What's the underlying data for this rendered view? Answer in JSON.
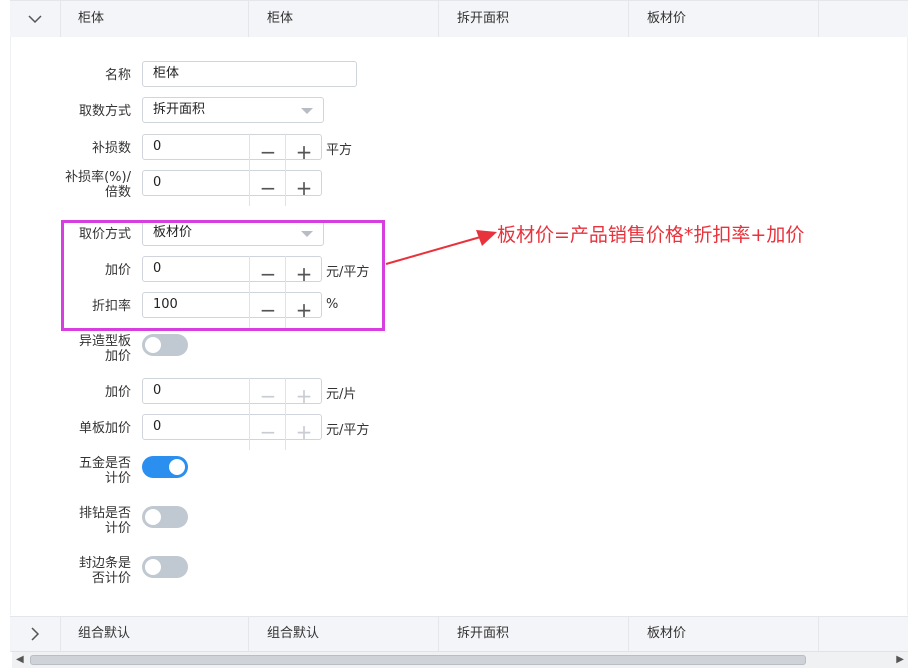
{
  "header_row": {
    "cells": [
      "柜体",
      "柜体",
      "拆开面积",
      "板材价"
    ]
  },
  "form": {
    "name": {
      "label": "名称",
      "value": "柜体"
    },
    "fetch_mode": {
      "label": "取数方式",
      "value": "拆开面积"
    },
    "loss": {
      "label": "补损数",
      "value": "0",
      "unit": "平方"
    },
    "loss_rate": {
      "label_line1": "补损率(%)/",
      "label_line2": "倍数",
      "value": "0"
    },
    "price_mode": {
      "label": "取价方式",
      "value": "板材价"
    },
    "add_price": {
      "label": "加价",
      "value": "0",
      "unit": "元/平方"
    },
    "discount": {
      "label": "折扣率",
      "value": "100",
      "unit": "%"
    },
    "special_board": {
      "label_line1": "异造型板",
      "label_line2": "加价",
      "on": false
    },
    "add_price2": {
      "label": "加价",
      "value": "0",
      "unit": "元/片"
    },
    "single_board": {
      "label": "单板加价",
      "value": "0",
      "unit": "元/平方"
    },
    "hardware": {
      "label_line1": "五金是否",
      "label_line2": "计价",
      "on": true
    },
    "drilling": {
      "label_line1": "排钻是否",
      "label_line2": "计价",
      "on": false
    },
    "edge_band": {
      "label_line1": "封边条是",
      "label_line2": "否计价",
      "on": false
    }
  },
  "annotation": "板材价=产品销售价格*折扣率+加价",
  "footer_row": {
    "cells": [
      "组合默认",
      "组合默认",
      "拆开面积",
      "板材价"
    ]
  },
  "colors": {
    "highlight": "#d63ee0",
    "annotation": "#e8323c",
    "switch_on": "#2b8ff0"
  }
}
